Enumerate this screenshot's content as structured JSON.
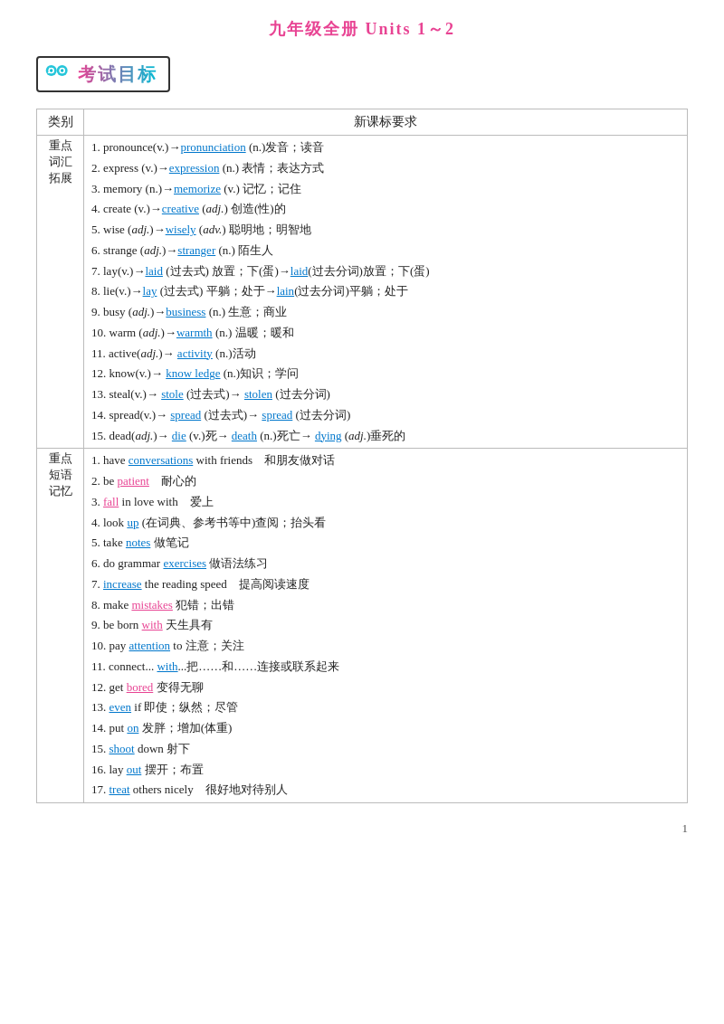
{
  "header": {
    "title": "九年级全册 Units 1～2",
    "exam_label": "考试目标"
  },
  "table": {
    "col1": "类别",
    "col2": "新课标要求",
    "sections": [
      {
        "category": "重点\n词汇\n拓展",
        "items": [
          "1. pronounce(v.)→pronunciation (n.)发音；读音",
          "2. express (v.)→expression (n.) 表情；表达方式",
          "3. memory (n.)→memorize (v.) 记忆；记住",
          "4. create (v.)→creative (adj.) 创造(性)的",
          "5. wise (adj.)→wisely (adv.) 聪明地；明智地",
          "6. strange (adj.)→stranger (n.) 陌生人",
          "7. lay(v.)→laid (过去式) 放置；下(蛋)→laid(过去分词)放置；下(蛋)",
          "8. lie(v.)→lay (过去式) 平躺；处于→lain(过去分词)平躺；处于",
          "9. busy (adj.)→business (n.) 生意；商业",
          "10. warm (adj.)→warmth (n.) 温暖；暖和",
          "11. active(adj.)→ activity (n.)活动",
          "12. know(v.)→ knowledge (n.)知识；学问",
          "13. steal(v.)→ stole (过去式)→ stolen (过去分词)",
          "14. spread(v.)→ spread (过去式)→ spread (过去分词)",
          "15. dead(adj.)→ die (v.)死→ death (n.)死亡→ dying (adj.)垂死的"
        ],
        "underlines": {
          "1": [
            "pronunciation"
          ],
          "2": [
            "expression"
          ],
          "3": [
            "memorize"
          ],
          "4": [
            "creative"
          ],
          "5": [
            "wisely"
          ],
          "6": [
            "stranger"
          ],
          "7": [
            "laid",
            "laid"
          ],
          "8": [
            "lay",
            "lain"
          ],
          "9": [
            "business"
          ],
          "10": [
            "warmth"
          ],
          "11": [
            "activity"
          ],
          "12": [
            "knowledge"
          ],
          "13": [
            "stole",
            "stolen"
          ],
          "14": [
            "spread",
            "spread"
          ],
          "15": [
            "die",
            "death",
            "dying"
          ]
        }
      },
      {
        "category": "重点\n短语\n记忆",
        "items": [
          "1. have conversations with friends　和朋友做对话",
          "2. be patient　耐心的",
          "3. fall in love with　爱上",
          "4. look up (在词典、参考书等中)查阅；抬头看",
          "5. take notes 做笔记",
          "6. do grammar exercises 做语法练习",
          "7. increase the reading speed　提高阅读速度",
          "8. make mistakes 犯错；出错",
          "9. be born with 天生具有",
          "10. pay attention to 注意；关注",
          "11. connect... with...把……和……连接或联系起来",
          "12. get bored 变得无聊",
          "13. even if 即使；纵然；尽管",
          "14. put on 发胖；增加(体重)",
          "15. shoot down 射下",
          "16. lay out 摆开；布置",
          "17. treat others nicely　很好地对待别人"
        ]
      }
    ]
  },
  "page_number": "1"
}
